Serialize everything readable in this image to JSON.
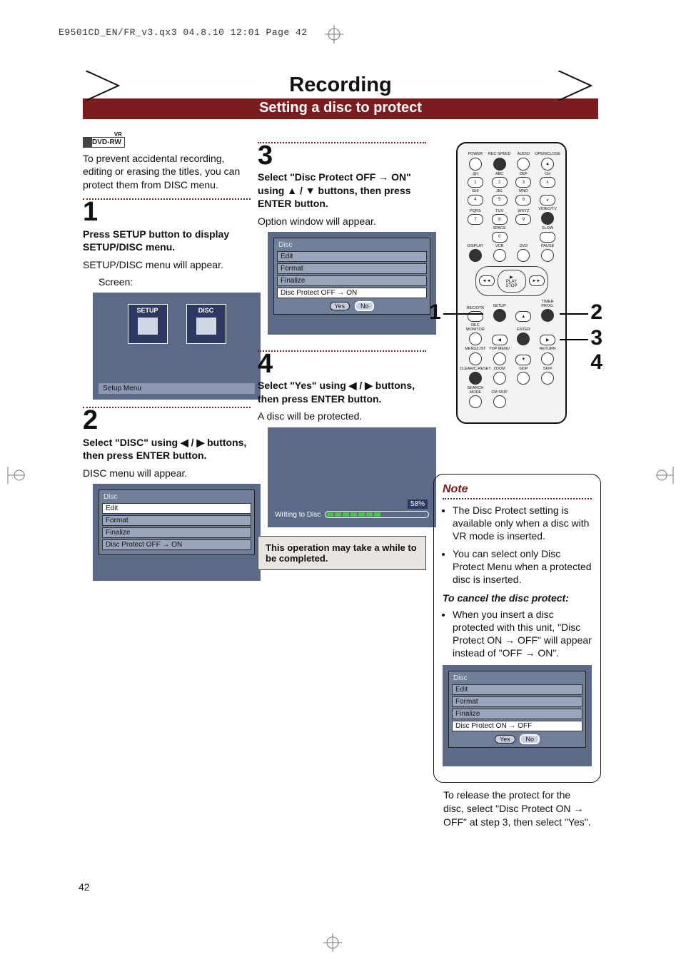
{
  "meta_line": "E9501CD_EN/FR_v3.qx3  04.8.10  12:01  Page 42",
  "header": {
    "title": "Recording",
    "subtitle": "Setting a disc to protect"
  },
  "dvd_badge": {
    "label": "DVD-RW",
    "mode": "VR"
  },
  "intro": "To prevent accidental recording, editing or erasing the titles, you can protect them from DISC menu.",
  "step1": {
    "num": "1",
    "head": "Press SETUP button to display SETUP/DISC menu.",
    "body": "SETUP/DISC menu will appear.",
    "screen_label": "Screen:",
    "osd": {
      "tab_setup": "SETUP",
      "tab_disc": "DISC",
      "footer": "Setup Menu"
    }
  },
  "step2": {
    "num": "2",
    "head_a": "Select \"DISC\" using ",
    "head_b": " buttons, then press ENTER button.",
    "body": "DISC menu will appear.",
    "osd": {
      "title": "Disc",
      "items": [
        "Edit",
        "Format",
        "Finalize",
        "Disc Protect OFF → ON"
      ]
    }
  },
  "step3": {
    "num": "3",
    "head_a": "Select \"Disc Protect OFF → ON\" using ",
    "head_b": " buttons, then press ENTER button.",
    "body": "Option window will appear.",
    "osd": {
      "title": "Disc",
      "items": [
        "Edit",
        "Format",
        "Finalize",
        "Disc Protect OFF → ON"
      ],
      "buttons": [
        "Yes",
        "No"
      ],
      "selected": 1
    }
  },
  "step4": {
    "num": "4",
    "head_a": "Select \"Yes\" using ",
    "head_b": " buttons, then press ENTER button.",
    "body": "A disc will be protected.",
    "osd": {
      "pct": "58%",
      "label": "Writing to Disc",
      "segments": 7
    },
    "callout": "This operation may take a while to be completed."
  },
  "remote": {
    "row1": [
      "POWER",
      "REC SPEED",
      "AUDIO",
      "OPEN/CLOSE"
    ],
    "row1_glyph": [
      "⏻",
      "●",
      "◯",
      "▲"
    ],
    "numpad": [
      [
        ".@/:",
        "ABC",
        "DEF",
        "CH"
      ],
      [
        "1",
        "2",
        "3",
        "∧"
      ],
      [
        "GHI",
        "JKL",
        "MNO",
        ""
      ],
      [
        "4",
        "5",
        "6",
        "∨"
      ],
      [
        "PQRS",
        "TUV",
        "WXYZ",
        "VIDEO/TV"
      ],
      [
        "7",
        "8",
        "9",
        "●"
      ],
      [
        "",
        "SPACE",
        "",
        "SLOW"
      ],
      [
        "",
        "0",
        "",
        "↷"
      ],
      [
        "DISPLAY",
        "VCR",
        "DVD",
        "PAUSE"
      ],
      [
        "●",
        "⦿",
        "⊚",
        "❚❚"
      ]
    ],
    "play": {
      "play": "PLAY",
      "stop": "STOP",
      "rew": "◄◄",
      "ff": "►►"
    },
    "row_mid": [
      "REC/OTR",
      "SETUP",
      "",
      "TIMER PROG."
    ],
    "row_mid2": [
      "REC MONITOR",
      "",
      "ENTER",
      ""
    ],
    "row_mid3": [
      "MENU/LIST",
      "TOP MENU",
      "",
      "RETURN"
    ],
    "row_low": [
      "CLEAR/C.RESET",
      "ZOOM",
      "SKIP",
      "SKIP"
    ],
    "row_low2": [
      "SEARCH MODE",
      "CM SKIP",
      "",
      ""
    ],
    "callouts": {
      "c1": "1",
      "c2": "2",
      "c3": "3",
      "c4": "4"
    }
  },
  "note": {
    "title": "Note",
    "bullets": [
      "The Disc Protect setting is available only when a disc with VR mode is inserted.",
      "You can select only Disc Protect Menu when a protected disc is inserted."
    ],
    "cancel_title": "To cancel the disc protect:",
    "cancel_bullet": "When you insert a disc protected with this unit, \"Disc Protect ON → OFF\" will appear instead of  \"OFF → ON\".",
    "osd": {
      "title": "Disc",
      "items": [
        "Edit",
        "Format",
        "Finalize",
        "Disc Protect ON  → OFF"
      ],
      "buttons": [
        "Yes",
        "No"
      ],
      "selected": 1
    },
    "release": "To release the protect for the disc, select \"Disc Protect ON → OFF\" at step 3, then select \"Yes\"."
  },
  "chart_data": {
    "type": "bar",
    "title": "Writing to Disc progress",
    "categories": [
      "progress"
    ],
    "values": [
      58
    ],
    "ylim": [
      0,
      100
    ],
    "xlabel": "",
    "ylabel": "%"
  },
  "symbols": {
    "left": "◀",
    "right": "▶",
    "up": "▲",
    "down": "▼",
    "arrow": "→"
  },
  "page_number": "42"
}
